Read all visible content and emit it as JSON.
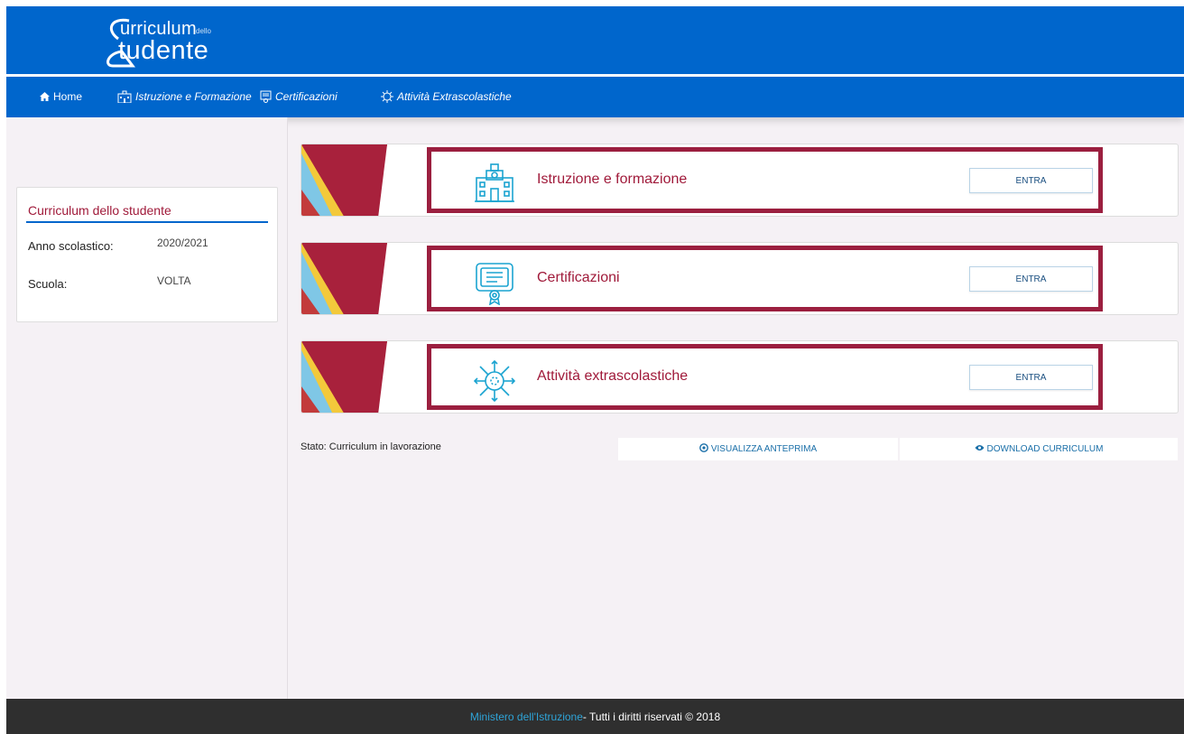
{
  "logo": {
    "line1": "urriculum",
    "small": "dello",
    "line2": "tudente"
  },
  "nav": {
    "home": "Home",
    "istruzione": "Istruzione e Formazione",
    "certificazioni": "Certificazioni",
    "attivita": "Attività Extrascolastiche"
  },
  "sidebar": {
    "title": "Curriculum dello studente",
    "rows": [
      {
        "label": "Anno scolastico:",
        "value": "2020/2021"
      },
      {
        "label": "Scuola:",
        "value": "VOLTA"
      }
    ]
  },
  "cards": [
    {
      "title": "Istruzione e formazione",
      "button": "ENTRA",
      "icon": "school-building-icon"
    },
    {
      "title": "Certificazioni",
      "button": "ENTRA",
      "icon": "certificate-icon"
    },
    {
      "title": "Attività extrascolastiche",
      "button": "ENTRA",
      "icon": "activities-icon"
    }
  ],
  "status": "Stato: Curriculum in lavorazione",
  "actions": {
    "preview": "VISUALIZZA ANTEPRIMA",
    "download": "DOWNLOAD CURRICULUM"
  },
  "footer": {
    "link": "Ministero dell'Istruzione",
    "text": " - Tutti i diritti riservati © 2018"
  },
  "colors": {
    "primary_blue": "#0066cc",
    "accent_red": "#a01a3a",
    "highlight_border": "#9b1f3f",
    "footer_bg": "#2f2f2f"
  }
}
